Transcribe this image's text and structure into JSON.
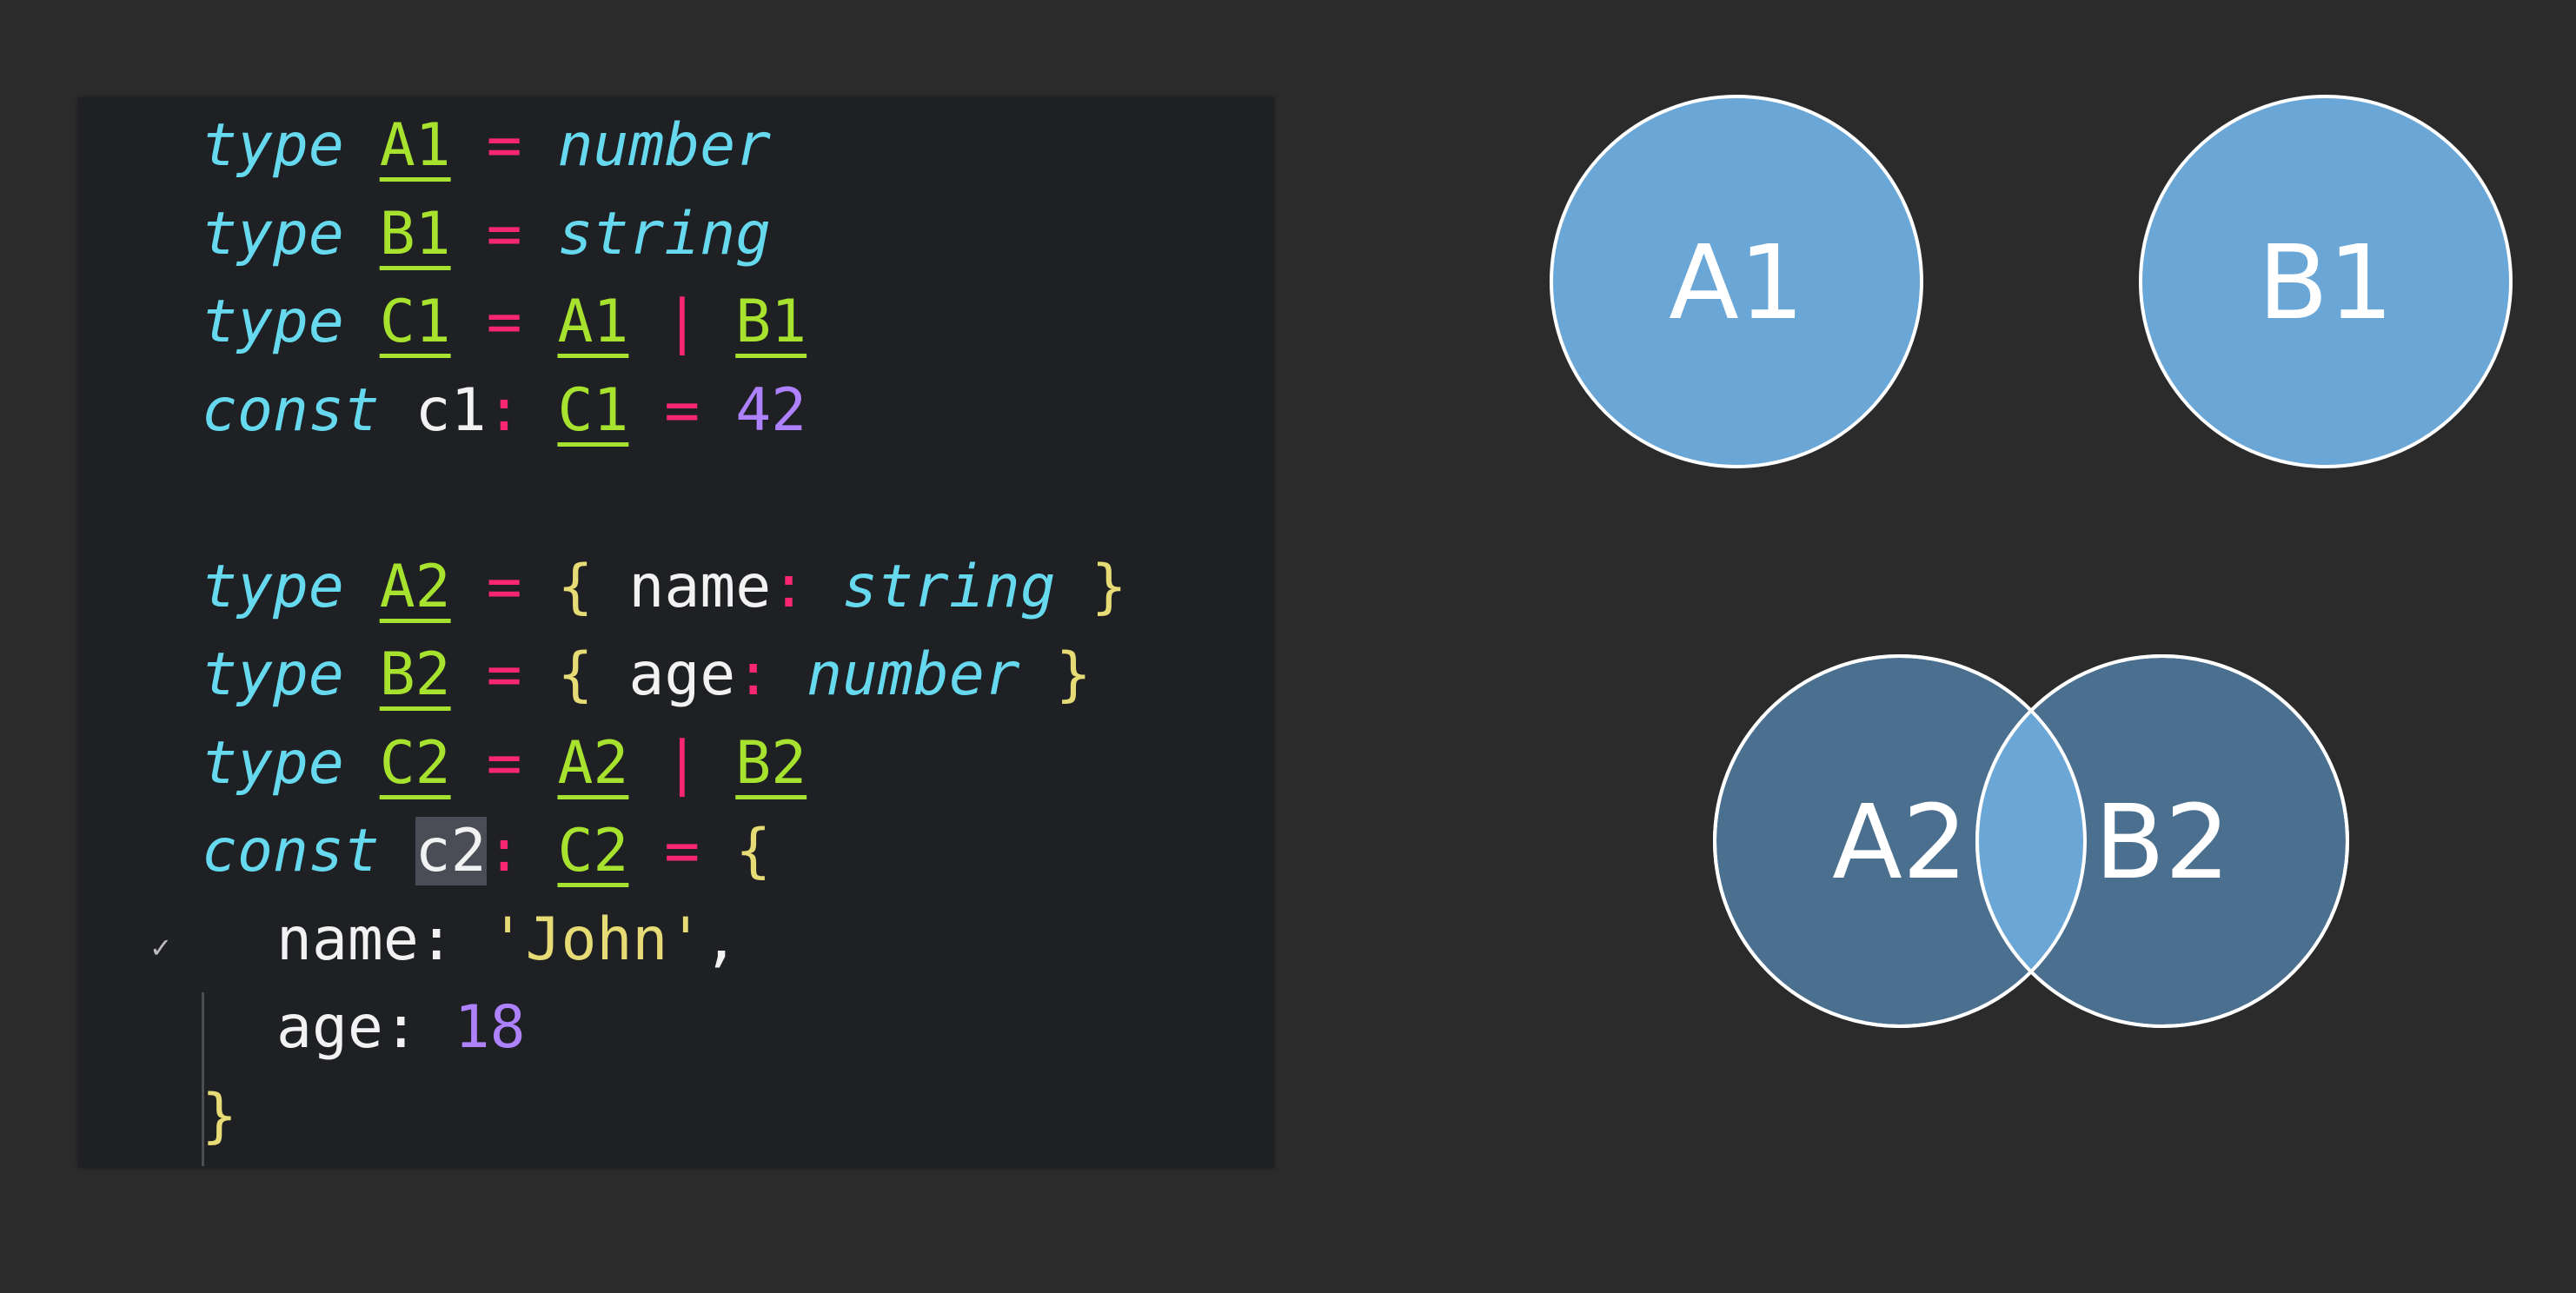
{
  "code": {
    "lines": [
      [
        {
          "c": "kw",
          "t": "type"
        },
        {
          "c": "punc",
          "t": " "
        },
        {
          "c": "ty",
          "t": "A1"
        },
        {
          "c": "punc",
          "t": " "
        },
        {
          "c": "op",
          "t": "="
        },
        {
          "c": "punc",
          "t": " "
        },
        {
          "c": "prim",
          "t": "number"
        }
      ],
      [
        {
          "c": "kw",
          "t": "type"
        },
        {
          "c": "punc",
          "t": " "
        },
        {
          "c": "ty",
          "t": "B1"
        },
        {
          "c": "punc",
          "t": " "
        },
        {
          "c": "op",
          "t": "="
        },
        {
          "c": "punc",
          "t": " "
        },
        {
          "c": "prim",
          "t": "string"
        }
      ],
      [
        {
          "c": "kw",
          "t": "type"
        },
        {
          "c": "punc",
          "t": " "
        },
        {
          "c": "ty",
          "t": "C1"
        },
        {
          "c": "punc",
          "t": " "
        },
        {
          "c": "op",
          "t": "="
        },
        {
          "c": "punc",
          "t": " "
        },
        {
          "c": "ty",
          "t": "A1"
        },
        {
          "c": "punc",
          "t": " "
        },
        {
          "c": "op",
          "t": "|"
        },
        {
          "c": "punc",
          "t": " "
        },
        {
          "c": "ty",
          "t": "B1"
        }
      ],
      [
        {
          "c": "kw",
          "t": "const"
        },
        {
          "c": "punc",
          "t": " "
        },
        {
          "c": "id",
          "t": "c1"
        },
        {
          "c": "op",
          "t": ":"
        },
        {
          "c": "punc",
          "t": " "
        },
        {
          "c": "ty",
          "t": "C1"
        },
        {
          "c": "punc",
          "t": " "
        },
        {
          "c": "op",
          "t": "="
        },
        {
          "c": "punc",
          "t": " "
        },
        {
          "c": "num",
          "t": "42"
        }
      ],
      [],
      [
        {
          "c": "kw",
          "t": "type"
        },
        {
          "c": "punc",
          "t": " "
        },
        {
          "c": "ty",
          "t": "A2"
        },
        {
          "c": "punc",
          "t": " "
        },
        {
          "c": "op",
          "t": "="
        },
        {
          "c": "punc",
          "t": " "
        },
        {
          "c": "brace",
          "t": "{"
        },
        {
          "c": "punc",
          "t": " "
        },
        {
          "c": "id",
          "t": "name"
        },
        {
          "c": "op",
          "t": ":"
        },
        {
          "c": "punc",
          "t": " "
        },
        {
          "c": "prim",
          "t": "string"
        },
        {
          "c": "punc",
          "t": " "
        },
        {
          "c": "brace",
          "t": "}"
        }
      ],
      [
        {
          "c": "kw",
          "t": "type"
        },
        {
          "c": "punc",
          "t": " "
        },
        {
          "c": "ty",
          "t": "B2"
        },
        {
          "c": "punc",
          "t": " "
        },
        {
          "c": "op",
          "t": "="
        },
        {
          "c": "punc",
          "t": " "
        },
        {
          "c": "brace",
          "t": "{"
        },
        {
          "c": "punc",
          "t": " "
        },
        {
          "c": "id",
          "t": "age"
        },
        {
          "c": "op",
          "t": ":"
        },
        {
          "c": "punc",
          "t": " "
        },
        {
          "c": "prim",
          "t": "number"
        },
        {
          "c": "punc",
          "t": " "
        },
        {
          "c": "brace",
          "t": "}"
        }
      ],
      [
        {
          "c": "kw",
          "t": "type"
        },
        {
          "c": "punc",
          "t": " "
        },
        {
          "c": "ty",
          "t": "C2"
        },
        {
          "c": "punc",
          "t": " "
        },
        {
          "c": "op",
          "t": "="
        },
        {
          "c": "punc",
          "t": " "
        },
        {
          "c": "ty",
          "t": "A2"
        },
        {
          "c": "punc",
          "t": " "
        },
        {
          "c": "op",
          "t": "|"
        },
        {
          "c": "punc",
          "t": " "
        },
        {
          "c": "ty",
          "t": "B2"
        }
      ],
      [
        {
          "c": "kw",
          "t": "const"
        },
        {
          "c": "punc",
          "t": " "
        },
        {
          "c": "id cursor-word",
          "t": "c2"
        },
        {
          "c": "op",
          "t": ":"
        },
        {
          "c": "punc",
          "t": " "
        },
        {
          "c": "ty",
          "t": "C2"
        },
        {
          "c": "punc",
          "t": " "
        },
        {
          "c": "op",
          "t": "="
        },
        {
          "c": "punc",
          "t": " "
        },
        {
          "c": "brace",
          "t": "{"
        }
      ],
      [
        {
          "c": "id",
          "t": "name: "
        },
        {
          "c": "str",
          "t": "'John'"
        },
        {
          "c": "punc",
          "t": ","
        }
      ],
      [
        {
          "c": "id",
          "t": "age: "
        },
        {
          "c": "num",
          "t": "18"
        }
      ],
      [
        {
          "c": "brace",
          "t": "}"
        }
      ]
    ],
    "gutter_mark": "✓"
  },
  "venn": {
    "top": [
      {
        "label": "A1",
        "fill": "#6aa6d6"
      },
      {
        "label": "B1",
        "fill": "#6aa6d6"
      }
    ],
    "bottom": [
      {
        "label": "A2",
        "fill": "#4a6f8f"
      },
      {
        "label": "B2",
        "fill": "#4a6f8f"
      }
    ],
    "overlap_fill": "#6aa6d6",
    "stroke": "#ffffff"
  },
  "colors": {
    "background": "#2b2b2b",
    "editor_background": "#1e2023"
  }
}
